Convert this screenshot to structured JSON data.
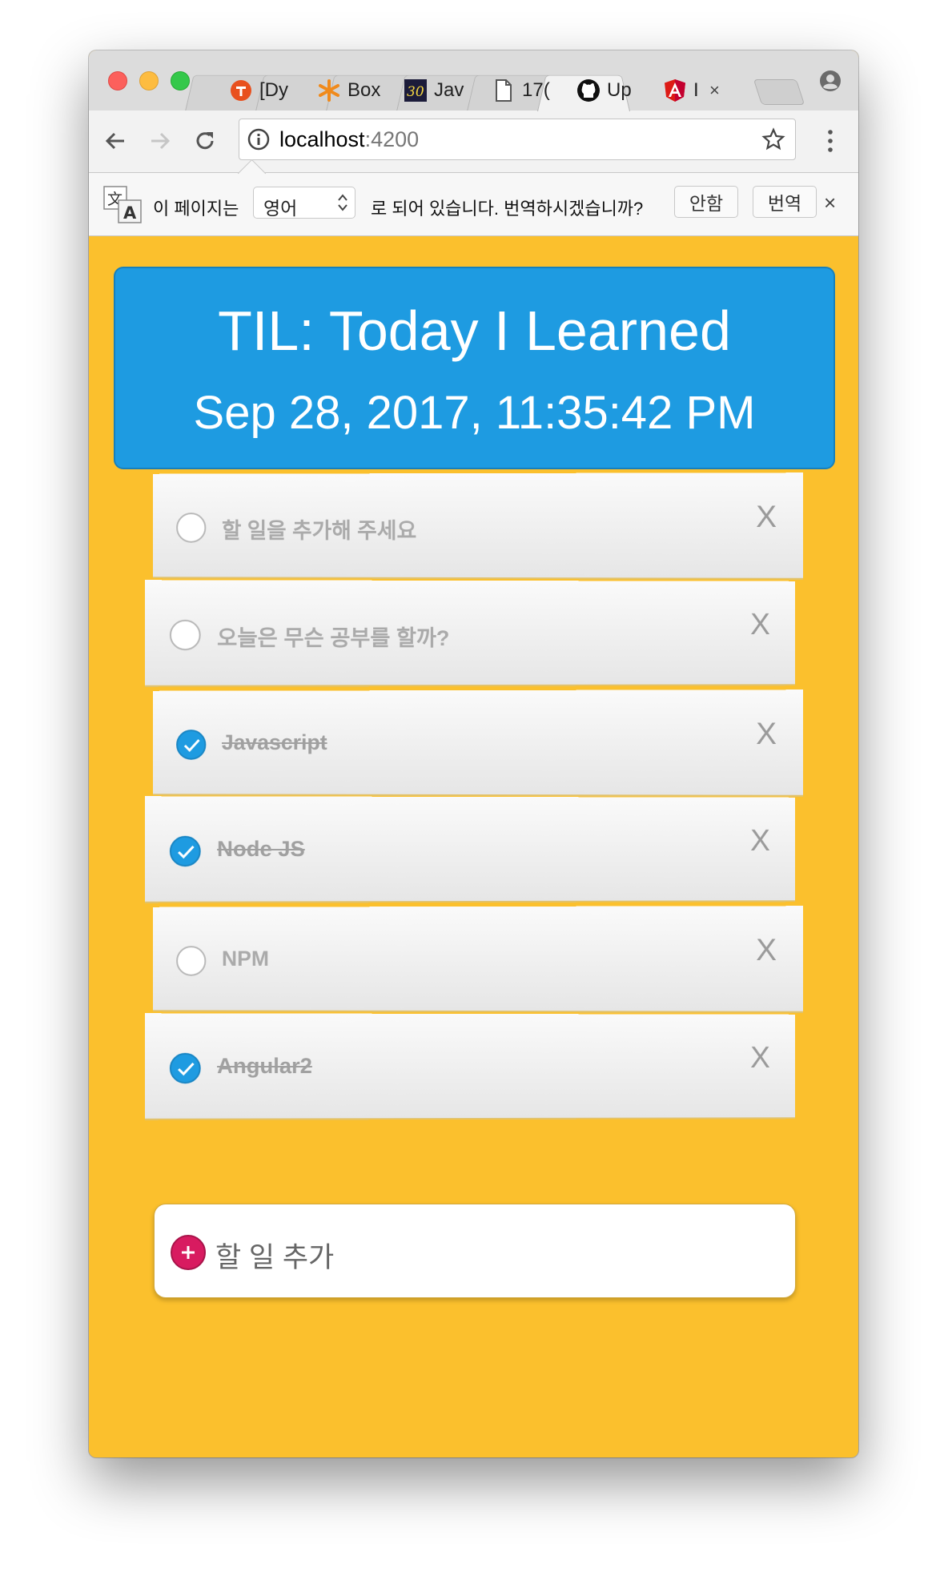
{
  "browser": {
    "tabs": [
      {
        "title": "[Dy",
        "icon": "red-circle-icon"
      },
      {
        "title": "Box",
        "icon": "orange-asterisk-icon"
      },
      {
        "title": "Jav",
        "icon": "javascript30-icon"
      },
      {
        "title": "17(",
        "icon": "document-icon"
      },
      {
        "title": "Up",
        "icon": "github-icon"
      },
      {
        "title": "I",
        "icon": "angular-icon",
        "active": true,
        "close": "×"
      }
    ],
    "url_host": "localhost",
    "url_port": ":4200"
  },
  "translate_bar": {
    "prefix": "이 페이지는",
    "language": "영어",
    "suffix": "로 되어 있습니다. 번역하시겠습니까?",
    "decline_label": "안함",
    "translate_label": "번역",
    "close_label": "×"
  },
  "app": {
    "title": "TIL: Today I Learned",
    "datetime": "Sep 28, 2017, 11:35:42 PM",
    "delete_label": "X",
    "todos": [
      {
        "text": "할 일을 추가해 주세요",
        "done": false
      },
      {
        "text": "오늘은 무슨 공부를 할까?",
        "done": false
      },
      {
        "text": "Javascript",
        "done": true
      },
      {
        "text": "Node JS",
        "done": true
      },
      {
        "text": "NPM",
        "done": false
      },
      {
        "text": "Angular2",
        "done": true
      }
    ],
    "add_placeholder": "할 일 추가"
  },
  "colors": {
    "background": "#fbc02d",
    "header": "#1e9be1",
    "add_button": "#d81b60",
    "checked": "#1e9be1"
  }
}
